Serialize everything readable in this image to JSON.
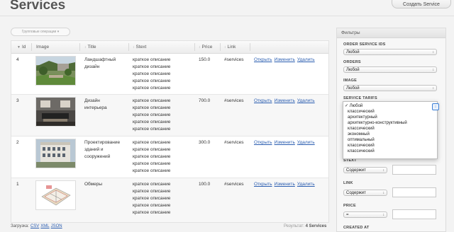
{
  "page": {
    "title": "Services",
    "create_button": "Создать Service"
  },
  "toolbar": {
    "group_actions": "Групповые операции ▾"
  },
  "table": {
    "headers": {
      "id": "Id",
      "image": "Image",
      "title": "Title",
      "stext": "Stext",
      "price": "Price",
      "link": "Link"
    },
    "rows": [
      {
        "id": "4",
        "title": [
          "Ландшафтный",
          "дизайн"
        ],
        "stext": [
          "краткое описание",
          "краткое описание",
          "краткое описание",
          "краткое описание",
          "краткое описание"
        ],
        "price": "150.0",
        "link": "#services",
        "image_kind": "garden",
        "actions": [
          "Открыть",
          "Изменить",
          "Удалить"
        ]
      },
      {
        "id": "3",
        "title": [
          "Дизайн",
          "интерьера"
        ],
        "stext": [
          "краткое описание",
          "краткое описание",
          "краткое описание",
          "краткое описание",
          "краткое описание"
        ],
        "price": "700.0",
        "link": "#services",
        "image_kind": "interior",
        "actions": [
          "Открыть",
          "Изменить",
          "Удалить"
        ]
      },
      {
        "id": "2",
        "title": [
          "Проектирование",
          "зданий и",
          "сооружений"
        ],
        "stext": [
          "краткое описание",
          "краткое описание",
          "краткое описание",
          "краткое описание",
          "краткое описание"
        ],
        "price": "300.0",
        "link": "#services",
        "image_kind": "building",
        "actions": [
          "Открыть",
          "Изменить",
          "Удалить"
        ]
      },
      {
        "id": "1",
        "title": [
          "Обмеры"
        ],
        "stext": [
          "краткое описание",
          "краткое описание",
          "краткое описание",
          "краткое описание",
          "краткое описание"
        ],
        "price": "100.0",
        "link": "#services",
        "image_kind": "plan",
        "actions": [
          "Открыть",
          "Изменить",
          "Удалить"
        ]
      }
    ]
  },
  "footer": {
    "export_label": "Загрузка:",
    "formats": [
      "CSV",
      "XML",
      "JSON"
    ],
    "results_label": "Результат:",
    "results_count": "4 Services"
  },
  "filters": {
    "heading": "Фильтры",
    "order_service_ids": {
      "label": "ORDER SERVICE IDS",
      "value": "Любой"
    },
    "orders": {
      "label": "ORDERS",
      "value": "Любой"
    },
    "image": {
      "label": "IMAGE",
      "value": "Любой"
    },
    "service_tarifs": {
      "label": "SERVICE TARIFS",
      "options": [
        "Любой",
        "классический",
        "архитектурный",
        "архитектурно-конструктивный",
        "классический",
        "экономный",
        "оптимальный",
        "классический",
        "классический"
      ]
    },
    "stext": {
      "label": "STEXT",
      "value": "Содержит"
    },
    "link": {
      "label": "LINK",
      "value": "Содержит"
    },
    "price": {
      "label": "PRICE",
      "value": "="
    },
    "created_at": {
      "label": "CREATED AT"
    }
  }
}
